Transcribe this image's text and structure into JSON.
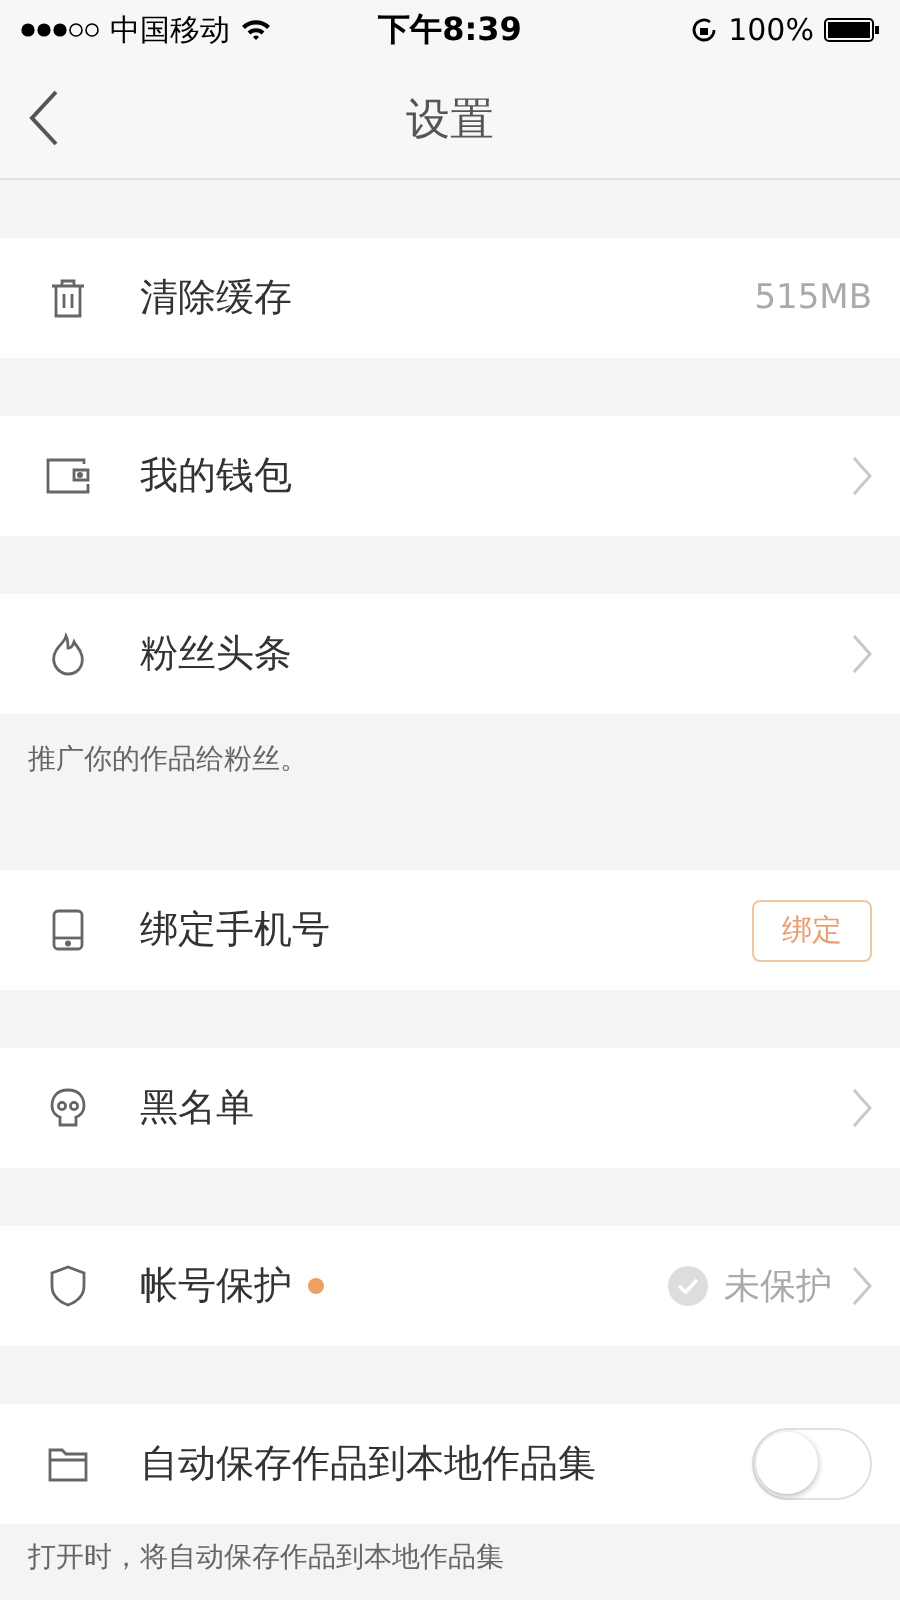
{
  "status_bar": {
    "carrier": "中国移动",
    "time": "下午8:39",
    "battery": "100%"
  },
  "nav": {
    "title": "设置"
  },
  "sections": [
    {
      "items": [
        {
          "kind": "value",
          "label": "清除缓存",
          "value": "515MB"
        }
      ]
    },
    {
      "items": [
        {
          "kind": "chevron",
          "label": "我的钱包"
        }
      ]
    },
    {
      "items": [
        {
          "kind": "chevron",
          "label": "粉丝头条"
        }
      ],
      "note": "推广你的作品给粉丝。"
    },
    {
      "items": [
        {
          "kind": "button",
          "label": "绑定手机号",
          "button": "绑定"
        }
      ]
    },
    {
      "items": [
        {
          "kind": "chevron",
          "label": "黑名单"
        }
      ]
    },
    {
      "items": [
        {
          "kind": "status",
          "label": "帐号保护",
          "color": "#f0a060",
          "status": "未保护"
        }
      ]
    },
    {
      "items": [
        {
          "kind": "toggle",
          "label": "自动保存作品到本地作品集",
          "on": false
        }
      ],
      "note": "打开时，将自动保存作品到本地作品集"
    }
  ]
}
